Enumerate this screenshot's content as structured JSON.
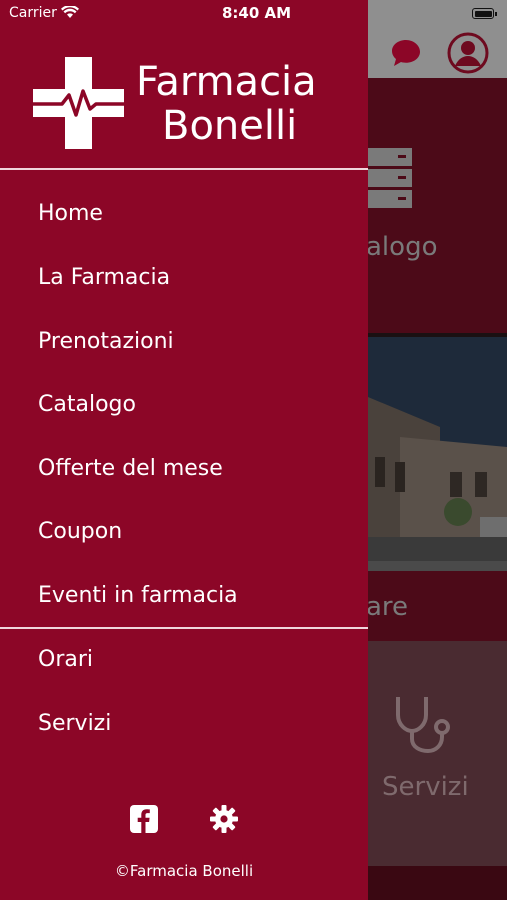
{
  "status_bar": {
    "carrier": "Carrier",
    "time": "8:40 AM"
  },
  "brand": {
    "line1": "Farmacia",
    "line2": "Bonelli"
  },
  "menu": {
    "primary": [
      "Home",
      "La Farmacia",
      "Prenotazioni",
      "Catalogo",
      "Offerte del mese",
      "Coupon",
      "Eventi in farmacia"
    ],
    "secondary": [
      "Orari",
      "Servizi"
    ]
  },
  "footer": {
    "copyright": "©Farmacia Bonelli"
  },
  "background": {
    "tile_catalog_label": "alogo",
    "tile_prenota_label": "are",
    "tile_servizi_label": "Servizi"
  },
  "colors": {
    "drawer": "#8c0627",
    "text": "#ffffff"
  },
  "icons": {
    "topbar": [
      "chat-icon",
      "user-icon"
    ],
    "footer": [
      "facebook-icon",
      "settings-icon"
    ]
  }
}
